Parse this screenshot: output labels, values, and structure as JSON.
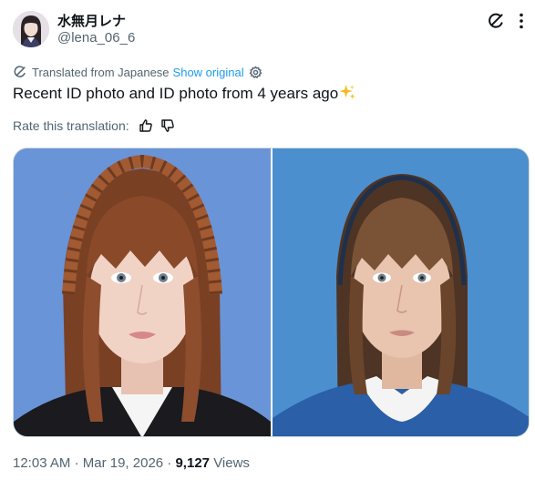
{
  "author": {
    "display_name": "水無月レナ",
    "handle": "@lena_06_6"
  },
  "translation": {
    "label": "Translated from Japanese",
    "show_original": "Show original",
    "rate_label": "Rate this translation:"
  },
  "tweet": {
    "text": "Recent ID photo and ID photo from 4 years ago"
  },
  "meta": {
    "time": "12:03 AM",
    "separator": "·",
    "date": "Mar 19, 2026",
    "views_count": "9,127",
    "views_label": "Views"
  },
  "icons": {
    "grok": "grok-icon",
    "more": "more-icon",
    "translate": "translate-icon",
    "settings": "settings-gear-icon",
    "thumbs_up": "thumbs-up-icon",
    "thumbs_down": "thumbs-down-icon",
    "sparkle": "sparkles-emoji"
  },
  "colors": {
    "accent": "#1d9bf0",
    "text_primary": "#0f1419",
    "text_secondary": "#536471",
    "photo_left_bg": "#6a94d8",
    "photo_right_bg": "#4b8fcf"
  }
}
